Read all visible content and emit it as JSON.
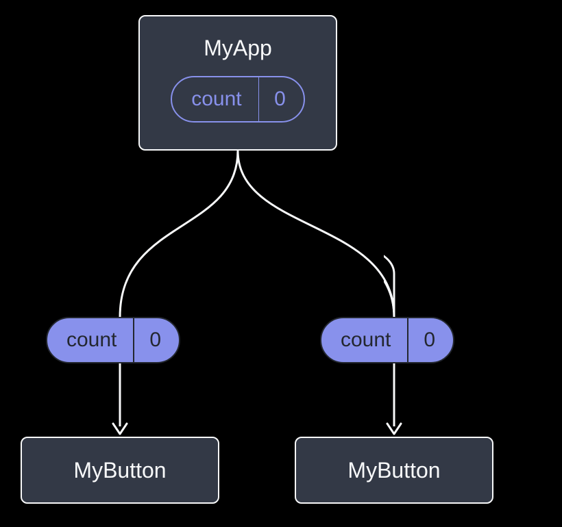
{
  "parent": {
    "title": "MyApp",
    "state": {
      "label": "count",
      "value": "0"
    }
  },
  "props": {
    "left": {
      "label": "count",
      "value": "0"
    },
    "right": {
      "label": "count",
      "value": "0"
    }
  },
  "children": {
    "left": {
      "title": "MyButton"
    },
    "right": {
      "title": "MyButton"
    }
  },
  "colors": {
    "bg": "#000000",
    "box_bg": "#333946",
    "line": "#f8f9fa",
    "accent": "#8891ec",
    "dark_stroke": "#23272f"
  }
}
